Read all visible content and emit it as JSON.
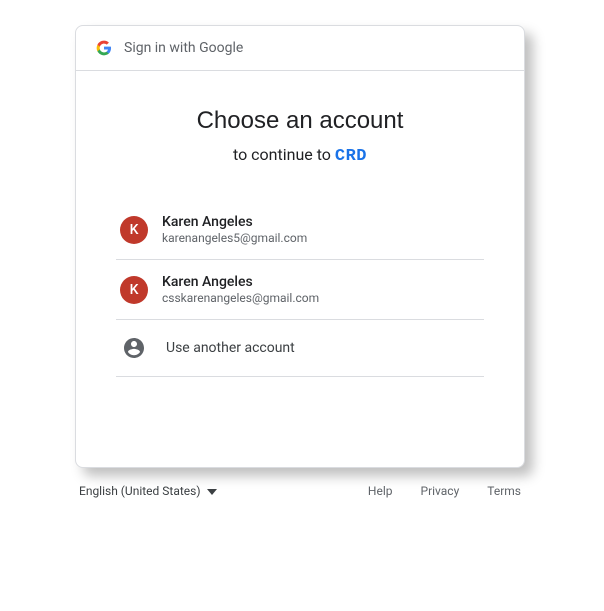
{
  "header": {
    "title": "Sign in with Google"
  },
  "main": {
    "title": "Choose an account",
    "subtitle_prefix": "to continue to ",
    "app_name": "CRD"
  },
  "accounts": [
    {
      "initial": "K",
      "name": "Karen Angeles",
      "email": "karenangeles5@gmail.com"
    },
    {
      "initial": "K",
      "name": "Karen Angeles",
      "email": "csskarenangeles@gmail.com"
    }
  ],
  "use_another": "Use another account",
  "footer": {
    "language": "English (United States)",
    "links": {
      "help": "Help",
      "privacy": "Privacy",
      "terms": "Terms"
    }
  }
}
